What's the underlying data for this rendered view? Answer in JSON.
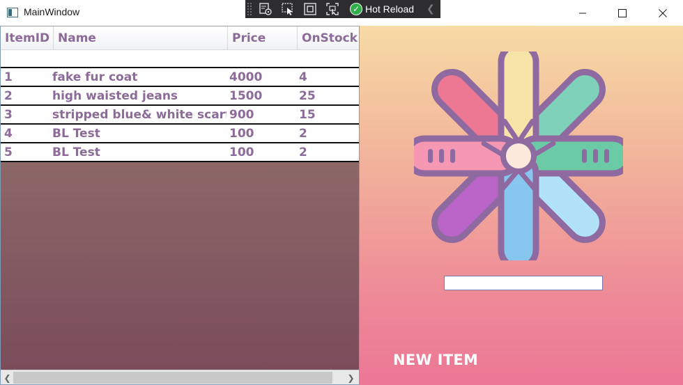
{
  "window": {
    "title": "MainWindow",
    "icon": "window-app-icon"
  },
  "hot_reload_toolbar": {
    "label": "Hot Reload",
    "buttons": [
      "live-visual-tree-icon",
      "select-element-icon",
      "display-layout-adorners-icon",
      "track-focused-element-icon"
    ],
    "status_color": "#2fb04a"
  },
  "window_controls": {
    "minimize": "minimize-icon",
    "maximize": "maximize-icon",
    "close": "close-icon"
  },
  "grid": {
    "columns": [
      "ItemID",
      "Name",
      "Price",
      "OnStock"
    ],
    "rows": [
      [
        "1",
        "fake fur coat",
        "4000",
        "4"
      ],
      [
        "2",
        "high waisted jeans",
        "1500",
        "25"
      ],
      [
        "3",
        "stripped blue& white scarf",
        "900",
        "15"
      ],
      [
        "4",
        "BL Test",
        "100",
        "2"
      ],
      [
        "5",
        "BL Test",
        "100",
        "2"
      ]
    ],
    "text_color": "#8c6a99"
  },
  "right_panel": {
    "logo": "flower-logo",
    "input_value": "",
    "new_item_label": "NEW ITEM"
  },
  "colors": {
    "accent_purple": "#8c6a99",
    "right_gradient_top": "#f7dba5",
    "right_gradient_bottom": "#ec7796",
    "left_gradient_top": "#9a7c6c",
    "left_gradient_bottom": "#7a4a5a"
  }
}
